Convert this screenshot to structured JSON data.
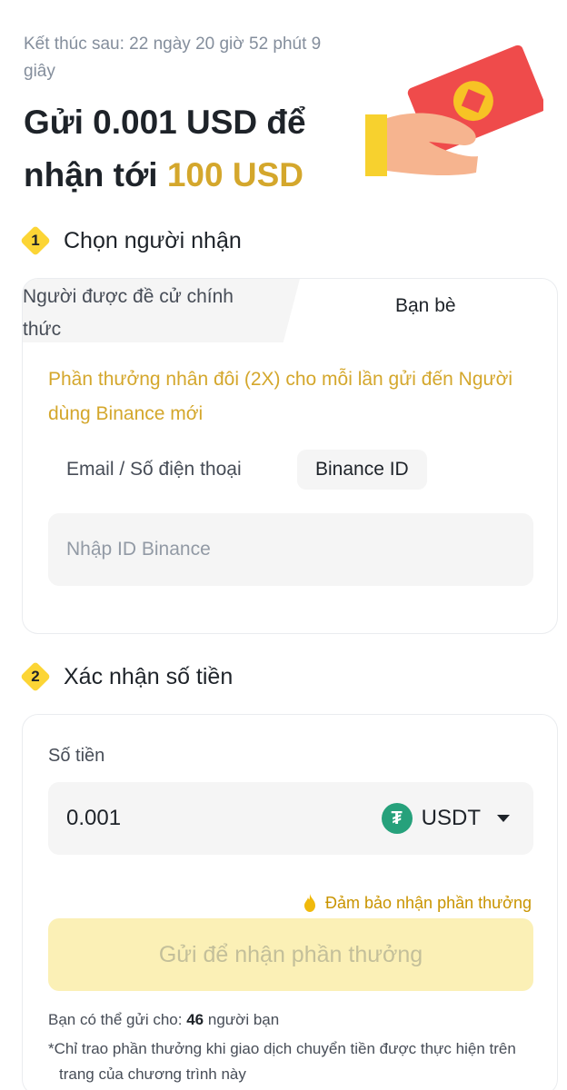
{
  "countdown": "Kết thúc sau: 22 ngày 20 giờ 52 phút 9 giây",
  "headline": {
    "prefix": "Gửi 0.001 USD để nhận tới",
    "amount": "100 USD"
  },
  "colors": {
    "accent": "#fcd535",
    "gold_text": "#d4a72c",
    "tether": "#26a17b"
  },
  "step1": {
    "number": "1",
    "title": "Chọn người nhận",
    "tabs": [
      {
        "label": "Người được đề cử chính thức"
      },
      {
        "label": "Bạn bè"
      }
    ],
    "promo": "Phần thưởng nhân đôi (2X) cho mỗi lần gửi đến Người dùng Binance mới",
    "id_types": [
      {
        "label": "Email / Số điện thoại"
      },
      {
        "label": "Binance ID"
      }
    ],
    "id_input": {
      "placeholder": "Nhập ID Binance",
      "value": ""
    }
  },
  "step2": {
    "number": "2",
    "title": "Xác nhận số tiền",
    "amount_label": "Số tiền",
    "amount_value": "0.001",
    "currency": "USDT",
    "currency_icon": "tether-icon",
    "guarantee": "Đảm bảo nhận phần thưởng",
    "cta": "Gửi để nhận phần thưởng",
    "friends_prefix": "Bạn có thể gửi cho:",
    "friends_count": "46",
    "friends_suffix": "người bạn",
    "note": "*Chỉ trao phần thưởng khi giao dịch chuyển tiền được thực hiện trên trang của chương trình này"
  }
}
